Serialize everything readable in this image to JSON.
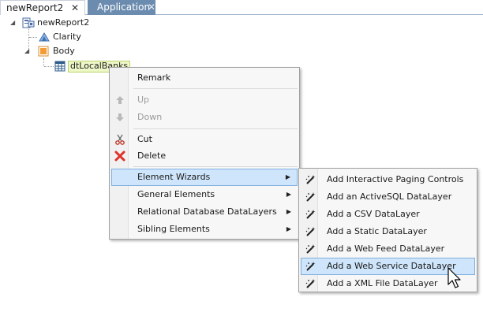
{
  "tabs": [
    {
      "label": "newReport2",
      "close": "✕"
    },
    {
      "label": "Application",
      "close": "✕"
    }
  ],
  "tree": {
    "root": "newReport2",
    "clarity": "Clarity",
    "body": "Body",
    "selected": "dtLocalBanks",
    "expand_glyph": "◢"
  },
  "context_menu": {
    "items": [
      {
        "label": "Remark"
      },
      {
        "label": "Up"
      },
      {
        "label": "Down"
      },
      {
        "label": "Cut"
      },
      {
        "label": "Delete"
      },
      {
        "label": "Element Wizards"
      },
      {
        "label": "General Elements"
      },
      {
        "label": "Relational Database DataLayers"
      },
      {
        "label": "Sibling Elements"
      }
    ],
    "submenu_arrow": "▶"
  },
  "wizards_menu": {
    "items": [
      {
        "label": "Add Interactive Paging Controls"
      },
      {
        "label": "Add an ActiveSQL DataLayer"
      },
      {
        "label": "Add a CSV DataLayer"
      },
      {
        "label": "Add a Static DataLayer"
      },
      {
        "label": "Add a Web Feed DataLayer"
      },
      {
        "label": "Add a Web Service DataLayer"
      },
      {
        "label": "Add a XML File DataLayer"
      }
    ]
  },
  "colors": {
    "accent": "#6b8caf",
    "hover_bg": "#cfe5fb",
    "hover_border": "#7fb0de",
    "selected_bg": "#eef7c7",
    "delete_red": "#e0302a"
  },
  "icons": {
    "up": "arrow-up-icon",
    "down": "arrow-down-icon",
    "cut": "scissors-icon",
    "delete": "red-x-icon",
    "wizard": "magic-wand-icon"
  }
}
